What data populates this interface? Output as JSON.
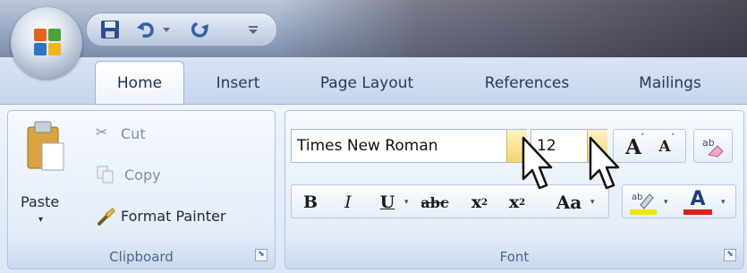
{
  "quick_access": {
    "save_icon": "save-icon",
    "undo_icon": "undo-icon",
    "redo_icon": "redo-icon",
    "customize_icon": "chevron-down-icon"
  },
  "tabs": [
    {
      "label": "Home",
      "active": true
    },
    {
      "label": "Insert"
    },
    {
      "label": "Page Layout"
    },
    {
      "label": "References"
    },
    {
      "label": "Mailings"
    }
  ],
  "clipboard": {
    "paste_label": "Paste",
    "cut_label": "Cut",
    "copy_label": "Copy",
    "format_painter_label": "Format Painter",
    "group_label": "Clipboard"
  },
  "font": {
    "font_name": "Times New Roman",
    "font_size": "12",
    "grow_label": "A",
    "shrink_label": "A",
    "bold_label": "B",
    "italic_label": "I",
    "underline_label": "U",
    "strike_label": "abc",
    "subscript_label": "x",
    "superscript_label": "x",
    "case_label": "Aa",
    "font_color_label": "A",
    "group_label": "Font"
  },
  "colors": {
    "accent": "#243a5c",
    "highlight": "#f2e600",
    "font_color": "#e0201c"
  }
}
